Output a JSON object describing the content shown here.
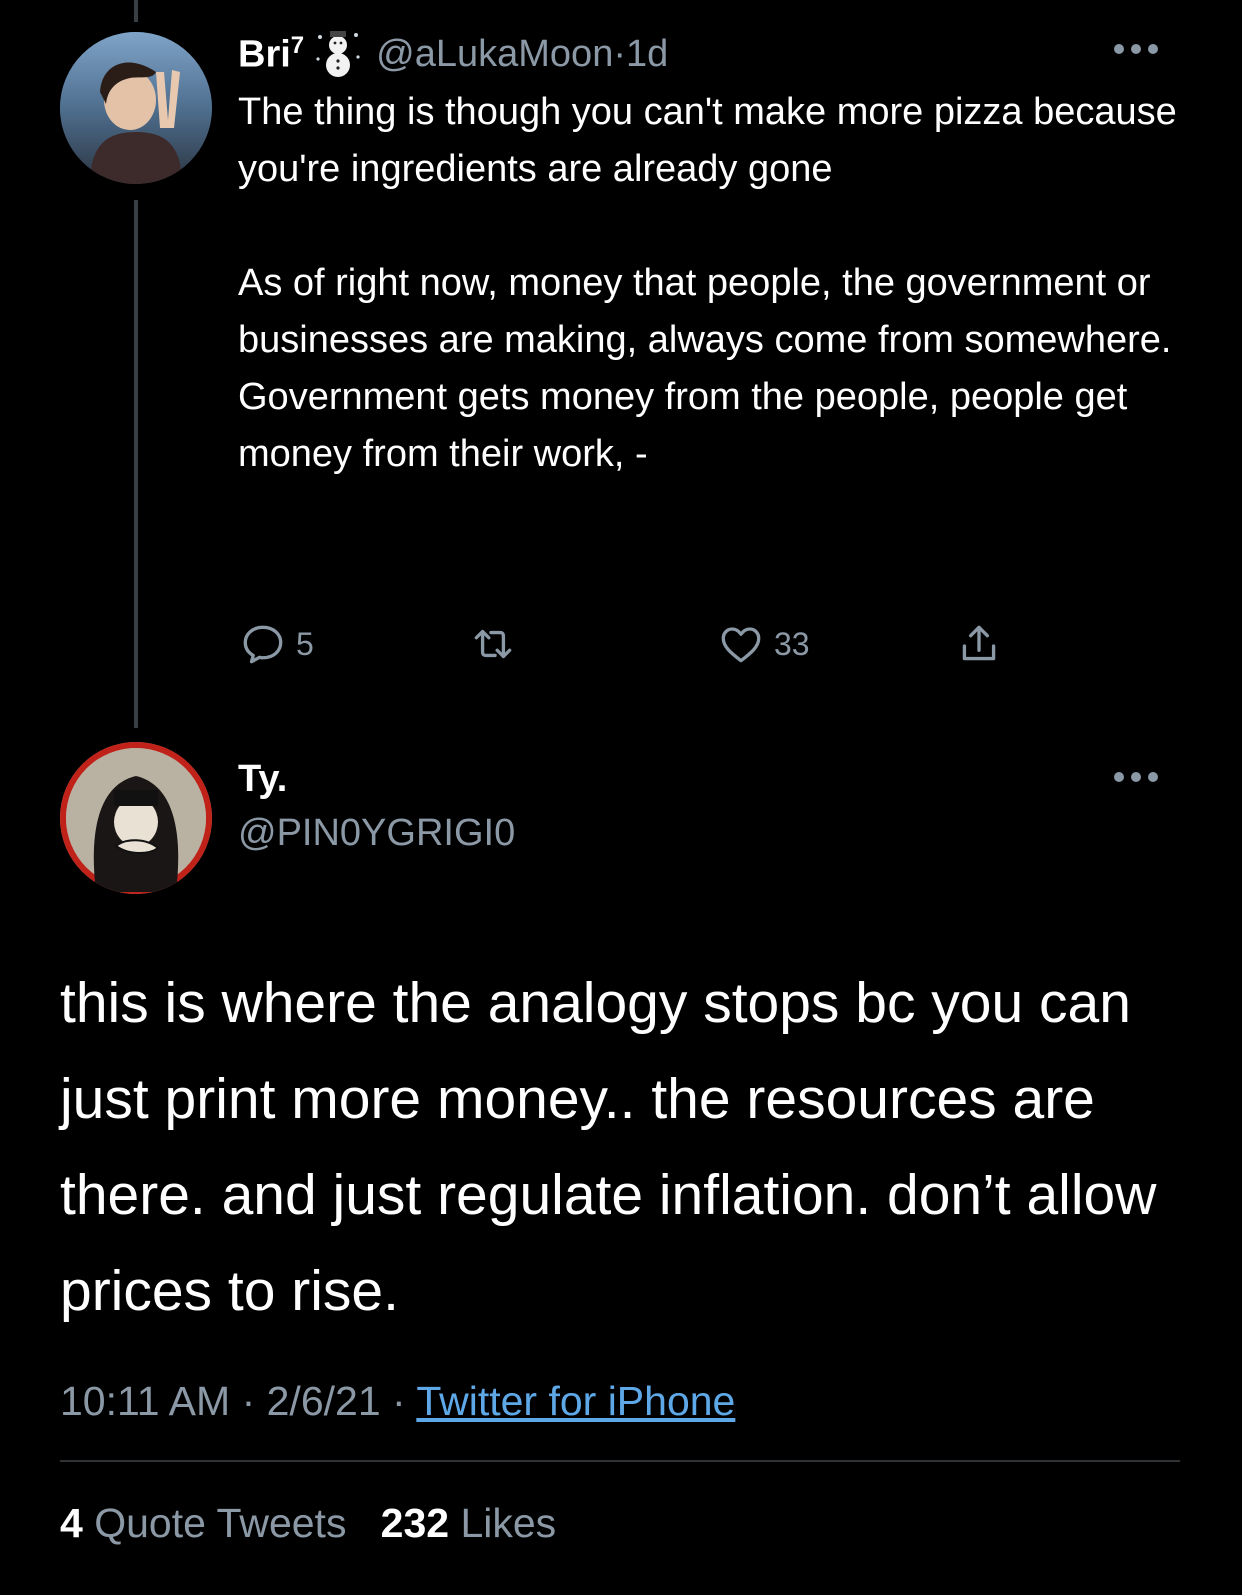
{
  "tweet1": {
    "display_name": "Bri",
    "name_superscript": "7",
    "name_emoji": "snowman-emoji",
    "handle": "@aLukaMoon",
    "separator": " · ",
    "age": "1d",
    "body_paragraphs": [
      "The thing is though you can't make more pizza because you're ingredients are already gone",
      "As of right now, money that people, the government or businesses are making, always come from somewhere. Government gets money from the people, people get money from their work, -"
    ],
    "actions": {
      "reply_count": "5",
      "retweet_count": "",
      "like_count": "33"
    },
    "icons": [
      "reply-icon",
      "retweet-icon",
      "like-icon",
      "share-icon",
      "more-icon"
    ]
  },
  "tweet2": {
    "display_name": "Ty.",
    "handle": "@PIN0YGRIGI0",
    "body": "this is where the analogy stops bc you can just print more money.. the resources are there. and just regulate inflation. don’t allow prices to rise.",
    "time": "10:11 AM",
    "separator": " · ",
    "date": "2/6/21",
    "source": "Twitter for iPhone",
    "stats": {
      "quote_count": "4",
      "quote_label": "Quote Tweets",
      "like_count": "232",
      "like_label": "Likes"
    }
  },
  "colors": {
    "background": "#000000",
    "text": "#ffffff",
    "secondary_text": "#8b98a5",
    "link": "#5ea8e8",
    "thread_line": "#3a3f44",
    "avatar_ring": "#c0221a"
  }
}
